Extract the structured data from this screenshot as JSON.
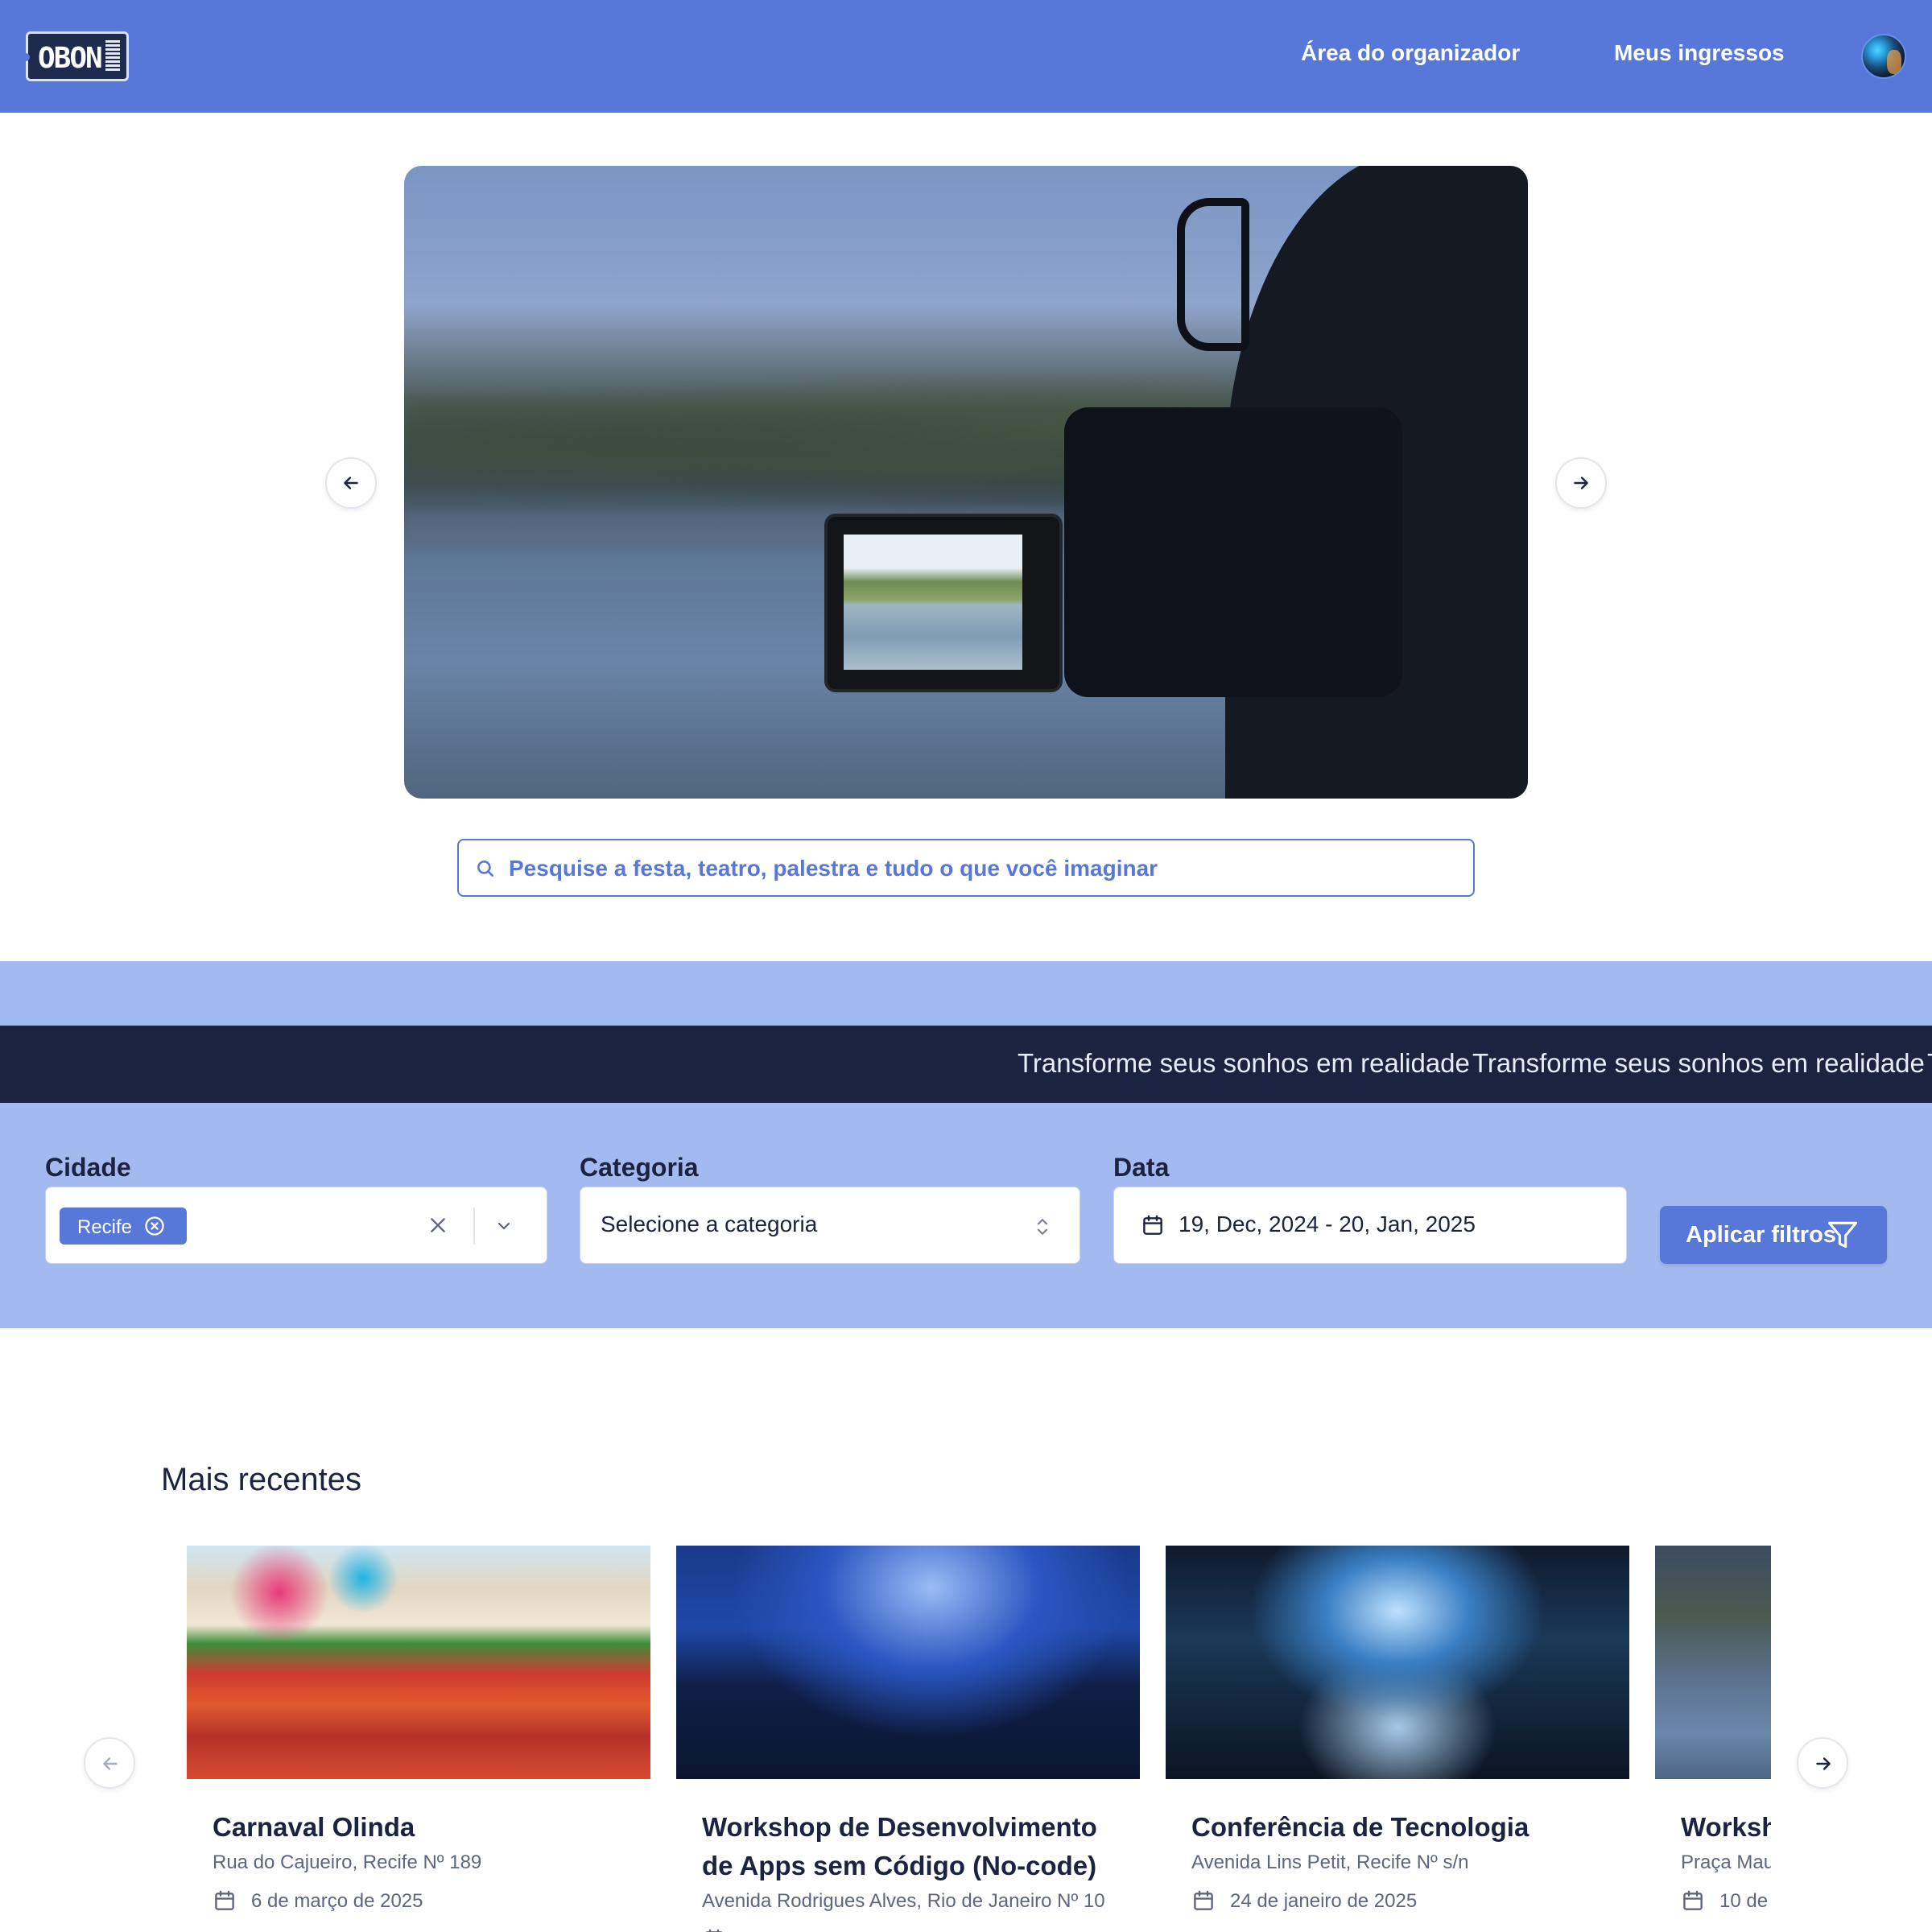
{
  "header": {
    "logo_text": "OBON",
    "nav": {
      "organizer_label": "Área do organizador",
      "tickets_label": "Meus ingressos"
    },
    "avatar_icon": "user-avatar",
    "background_color": "#5778d8"
  },
  "hero": {
    "prev_icon": "arrow-left-icon",
    "next_icon": "arrow-right-icon"
  },
  "search": {
    "placeholder": "Pesquise a festa, teatro, palestra e tudo o que você imaginar",
    "icon": "search-icon"
  },
  "marquee": {
    "text": "Transforme seus sonhos em realidade",
    "background_color": "#1c2340"
  },
  "filters": {
    "city_label": "Cidade",
    "city_selected_chip": "Recife",
    "category_label": "Categoria",
    "category_placeholder": "Selecione a categoria",
    "date_label": "Data",
    "date_value": "19, Dec, 2024 - 20, Jan, 2025",
    "apply_label": "Aplicar filtros",
    "band_color": "#a3baf0"
  },
  "recent": {
    "title": "Mais recentes",
    "events": [
      {
        "title": "Carnaval Olinda",
        "address": "Rua do Cajueiro, Recife Nº 189",
        "date": "6 de março de 2025"
      },
      {
        "title": "Workshop de Desenvolvimento de Apps sem Código (No-code)",
        "address": "Avenida Rodrigues Alves, Rio de Janeiro Nº 10",
        "date": ""
      },
      {
        "title": "Conferência de Tecnologia",
        "address": "Avenida Lins Petit, Recife Nº s/n",
        "date": "24 de janeiro de 2025"
      },
      {
        "title": "Workshop",
        "address": "Praça Mau",
        "date": "10 de"
      }
    ]
  }
}
